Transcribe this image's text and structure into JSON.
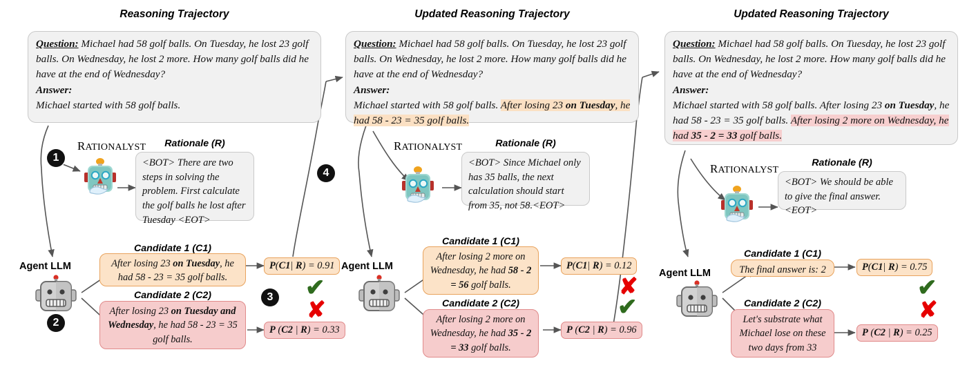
{
  "columns": [
    {
      "title": "Reasoning Trajectory",
      "question_label": "Question:",
      "question_text": " Michael had 58 golf balls. On Tuesday, he lost 23 golf balls. On Wednesday, he lost 2 more. How many golf balls did he have at the end of Wednesday?",
      "answer_label": "Answer:",
      "answer_plain": "Michael started with 58 golf balls.",
      "rationalyst_label": "Rationalyst",
      "rationale_title": "Rationale (R)",
      "rationale_text": "<BOT> There are two steps in solving the problem. First calculate the golf balls he lost after Tuesday <EOT>",
      "agent_label": "Agent LLM",
      "candidate1_title": "Candidate 1 (C1)",
      "candidate1_text": "After losing 23 on Tuesday, he had 58 - 23 = 35 golf balls.",
      "candidate2_title": "Candidate 2 (C2)",
      "candidate2_text": "After losing 23 on Tuesday and Wednesday, he had 58 - 23 = 35 golf balls.",
      "prob1": "P(C1| R) = 0.91",
      "prob2": "P (C2 | R) = 0.33",
      "verdict1": "correct",
      "verdict2": "incorrect"
    },
    {
      "title": "Updated Reasoning Trajectory",
      "question_label": "Question:",
      "question_text": " Michael had 58 golf balls. On Tuesday, he lost 23 golf balls. On Wednesday, he lost 2 more. How many golf balls did he have at the end of Wednesday?",
      "answer_label": "Answer:",
      "answer_plain": "Michael started with 58 golf balls. ",
      "answer_highlight": "After losing 23 on Tuesday, he had 58 - 23 = 35 golf balls.",
      "rationalyst_label": "Rationalyst",
      "rationale_title": "Rationale (R)",
      "rationale_text": "<BOT> Since Michael only has 35 balls, the next calculation should start from 35, not 58.<EOT>",
      "agent_label": "Agent LLM",
      "candidate1_title": "Candidate 1 (C1)",
      "candidate1_text": "After losing 2 more on Wednesday, he had 58 - 2 = 56 golf balls.",
      "candidate2_title": "Candidate 2 (C2)",
      "candidate2_text": "After losing 2 more on Wednesday, he had 35 - 2 = 33 golf balls.",
      "prob1": "P(C1| R) = 0.12",
      "prob2": "P (C2 | R) = 0.96",
      "verdict1": "incorrect",
      "verdict2": "correct"
    },
    {
      "title": "Updated Reasoning Trajectory",
      "question_label": "Question:",
      "question_text": " Michael had 58 golf balls. On Tuesday, he lost 23 golf balls. On Wednesday, he lost 2 more. How many golf balls did he have at the end of Wednesday?",
      "answer_label": "Answer:",
      "answer_plain": "Michael started with 58 golf balls. After losing 23 on Tuesday, he had 58 - 23 = 35 golf balls. ",
      "answer_highlight": "After losing 2 more on Wednesday, he had 35 - 2 = 33 golf balls.",
      "rationalyst_label": "Rationalyst",
      "rationale_title": "Rationale (R)",
      "rationale_text": "<BOT> We should be able to give the final answer.<EOT>",
      "agent_label": "Agent LLM",
      "candidate1_title": "Candidate 1 (C1)",
      "candidate1_text": "The final answer is: 2",
      "candidate2_title": "Candidate 2 (C2)",
      "candidate2_text": "Let's substrate what Michael lose on these two days from 33",
      "prob1": "P(C1| R) = 0.75",
      "prob2": "P (C2 | R) = 0.25",
      "verdict1": "correct",
      "verdict2": "incorrect"
    }
  ],
  "markers": [
    "1",
    "2",
    "3",
    "4"
  ],
  "glyphs": {
    "check": "✔",
    "cross": "✘"
  },
  "colors": {
    "candidate1_fill": "#fce3c8",
    "candidate1_border": "#e8a25c",
    "candidate2_fill": "#f6cccc",
    "candidate2_border": "#e08a8a",
    "box_fill": "#f1f1f1",
    "check_green": "#2f6b1e",
    "cross_red": "#e60000",
    "highlight_orange": "#fbe0c3",
    "highlight_pink": "#f7cfcf"
  }
}
